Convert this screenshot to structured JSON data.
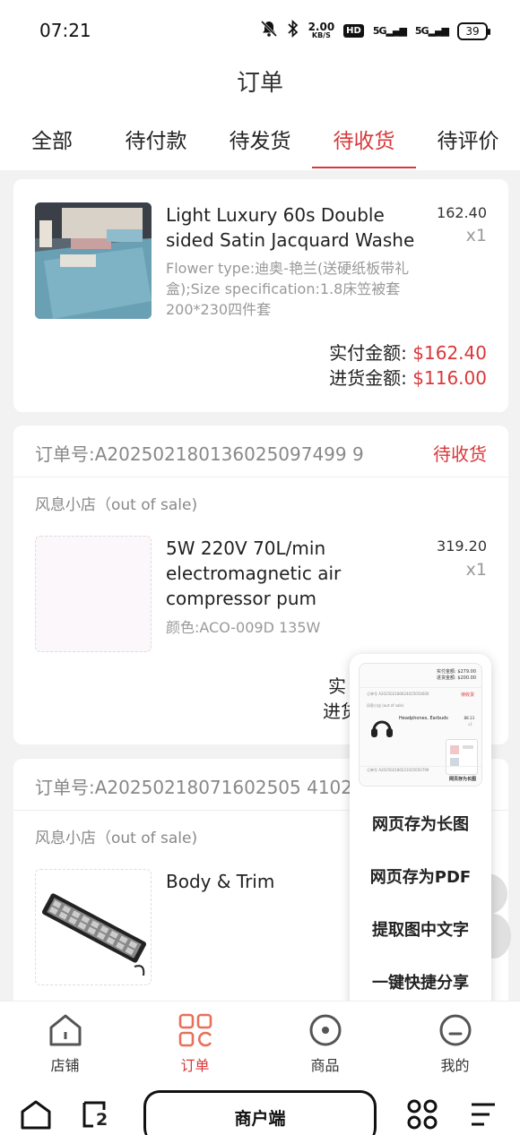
{
  "status_bar": {
    "time": "07:21",
    "net_speed_value": "2.00",
    "net_speed_unit": "KB/S",
    "hd_label": "HD",
    "sig1": "5G",
    "sig2": "5G",
    "battery": "39",
    "icons": [
      "mute-bell-icon",
      "bluetooth-icon",
      "signal-icon",
      "battery-icon"
    ]
  },
  "header": {
    "title": "订单",
    "tabs": [
      {
        "label": "全部"
      },
      {
        "label": "待付款"
      },
      {
        "label": "待发货"
      },
      {
        "label": "待收货",
        "active": true
      },
      {
        "label": "待评价"
      }
    ]
  },
  "orders": [
    {
      "product": {
        "name": "Light Luxury 60s Double sided Satin Jacquard Washe",
        "spec": "Flower type:迪奥-艳兰(送硬纸板带礼盒);Size specification:1.8床笠被套200*230四件套",
        "price": "162.40",
        "qty": "x1"
      },
      "paid_label": "实付金额:",
      "paid_amount": "$162.40",
      "cost_label": "进货金额:",
      "cost_amount": "$116.00"
    },
    {
      "order_no": "订单号:A202502180136025097499 9",
      "status": "待收货",
      "shop": "风息小店（out of sale)",
      "product": {
        "name": "5W 220V 70L/min electromagnetic air compressor pum",
        "spec": "颜色:ACO-009D 135W",
        "price": "319.20",
        "qty": "x1"
      },
      "paid_label_partial": "实",
      "cost_label_partial": "进货"
    },
    {
      "order_no": "订单号:A20250218071602505 41025",
      "shop": "风息小店（out of sale)",
      "product": {
        "name": "Body & Trim"
      }
    }
  ],
  "float_menu": {
    "preview": {
      "paid_label": "实付金额: $279.00",
      "cost_label": "进货金额: $200.00",
      "order_no": "订单号 A202502180624025054600",
      "status": "待收货",
      "shop": "风息小店 (out of sale)",
      "product_name": "Headphones, Earbuds",
      "price": "88.13",
      "qty": "x1",
      "order_no_2": "订单号 A202502180221025050799",
      "footer": "网页存为长图"
    },
    "items": [
      "网页存为长图",
      "网页存为PDF",
      "提取图中文字",
      "一键快捷分享"
    ]
  },
  "bottom_nav": [
    {
      "label": "店铺",
      "icon": "shop-icon"
    },
    {
      "label": "订单",
      "icon": "orders-grid-icon",
      "active": true
    },
    {
      "label": "商品",
      "icon": "product-circle-icon"
    },
    {
      "label": "我的",
      "icon": "profile-icon"
    }
  ],
  "system_bar": {
    "merchant_label": "商户端",
    "tabs_count": "2"
  },
  "colors": {
    "accent": "#d9383a",
    "background": "#f2f2f2"
  }
}
